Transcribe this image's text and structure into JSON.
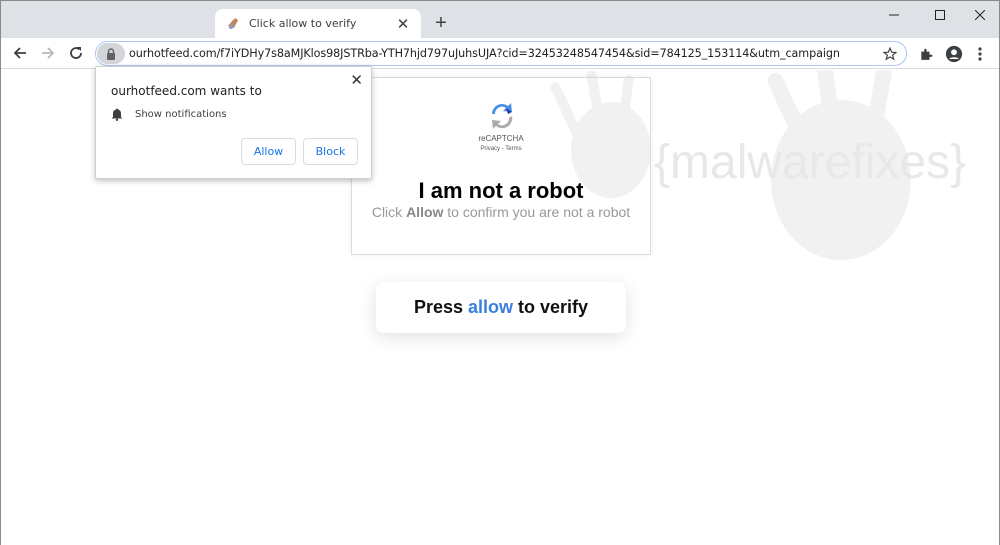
{
  "browser": {
    "tab": {
      "title": "Click allow to verify",
      "favicon": "puzzle-favicon-icon"
    },
    "new_tab_label": "+",
    "window_controls": [
      "minimize",
      "maximize",
      "close"
    ],
    "address_bar": {
      "url": "ourhotfeed.com/f7iYDHy7s8aMJKlos98JSTRba-YTH7hjd797uJuhsUJA?cid=32453248547454&sid=784125_153114&utm_campaign"
    }
  },
  "permission_popup": {
    "title": "ourhotfeed.com wants to",
    "permission": "Show notifications",
    "allow_label": "Allow",
    "block_label": "Block",
    "close_label": "✕"
  },
  "captcha": {
    "logo_label": "reCAPTCHA",
    "links": "Privacy - Terms",
    "title": "I am not a robot",
    "subtitle_prefix": "Click",
    "subtitle_bold": "Allow",
    "subtitle_suffix": "to confirm you are not a robot"
  },
  "verify_card": {
    "prefix": "Press",
    "highlight": "allow",
    "suffix": "to verify",
    "highlight_color": "#3a7fe0"
  },
  "watermark": {
    "text": "{malwarefixes}"
  }
}
